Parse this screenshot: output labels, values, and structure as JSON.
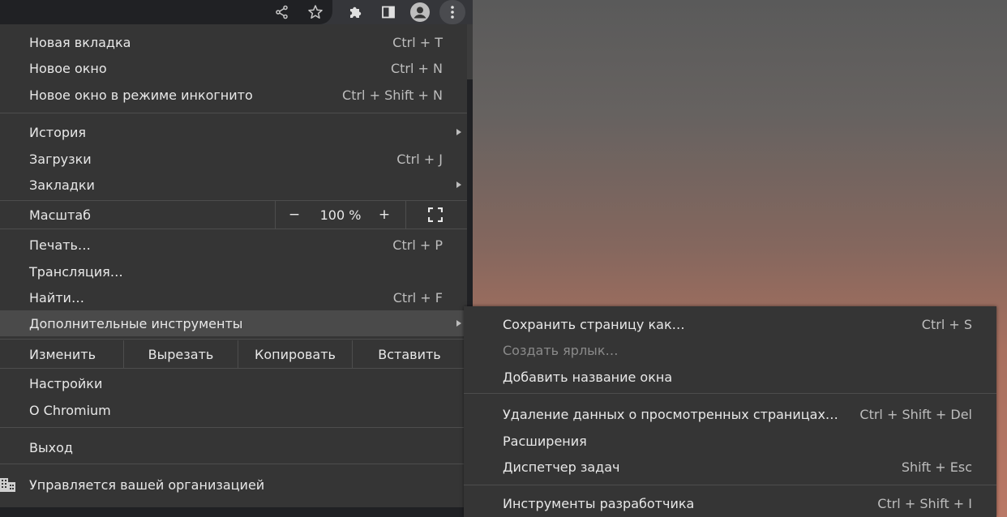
{
  "menu": {
    "new_tab": {
      "label": "Новая вкладка",
      "shortcut": "Ctrl + T"
    },
    "new_window": {
      "label": "Новое окно",
      "shortcut": "Ctrl + N"
    },
    "incognito": {
      "label": "Новое окно в режиме инкогнито",
      "shortcut": "Ctrl + Shift + N"
    },
    "history": {
      "label": "История"
    },
    "downloads": {
      "label": "Загрузки",
      "shortcut": "Ctrl + J"
    },
    "bookmarks": {
      "label": "Закладки"
    },
    "zoom": {
      "label": "Масштаб",
      "minus": "−",
      "value": "100 %",
      "plus": "+"
    },
    "print": {
      "label": "Печать…",
      "shortcut": "Ctrl + P"
    },
    "cast": {
      "label": "Трансляция…"
    },
    "find": {
      "label": "Найти…",
      "shortcut": "Ctrl + F"
    },
    "more_tools": {
      "label": "Дополнительные инструменты"
    },
    "edit": {
      "label": "Изменить",
      "cut": "Вырезать",
      "copy": "Копировать",
      "paste": "Вставить"
    },
    "settings": {
      "label": "Настройки"
    },
    "about": {
      "label": "О Chromium"
    },
    "exit": {
      "label": "Выход"
    },
    "managed": {
      "label": "Управляется вашей организацией"
    }
  },
  "submenu": {
    "save_page": {
      "label": "Сохранить страницу как…",
      "shortcut": "Ctrl + S"
    },
    "create_shortcut": {
      "label": "Создать ярлык…"
    },
    "name_window": {
      "label": "Добавить название окна"
    },
    "clear_data": {
      "label": "Удаление данных о просмотренных страницах…",
      "shortcut": "Ctrl + Shift + Del"
    },
    "extensions": {
      "label": "Расширения"
    },
    "task_manager": {
      "label": "Диспетчер задач",
      "shortcut": "Shift + Esc"
    },
    "dev_tools": {
      "label": "Инструменты разработчика",
      "shortcut": "Ctrl + Shift + I"
    }
  },
  "toolbar_icons": [
    "share-icon",
    "star-icon",
    "extensions-icon",
    "side-panel-icon",
    "profile-icon",
    "more-vertical-icon"
  ],
  "colors": {
    "menu_bg": "#353535",
    "highlight": "#4a4a4a",
    "text": "#e8e8e8",
    "shortcut": "#bdbdbd",
    "disabled": "#8a8a8a"
  }
}
